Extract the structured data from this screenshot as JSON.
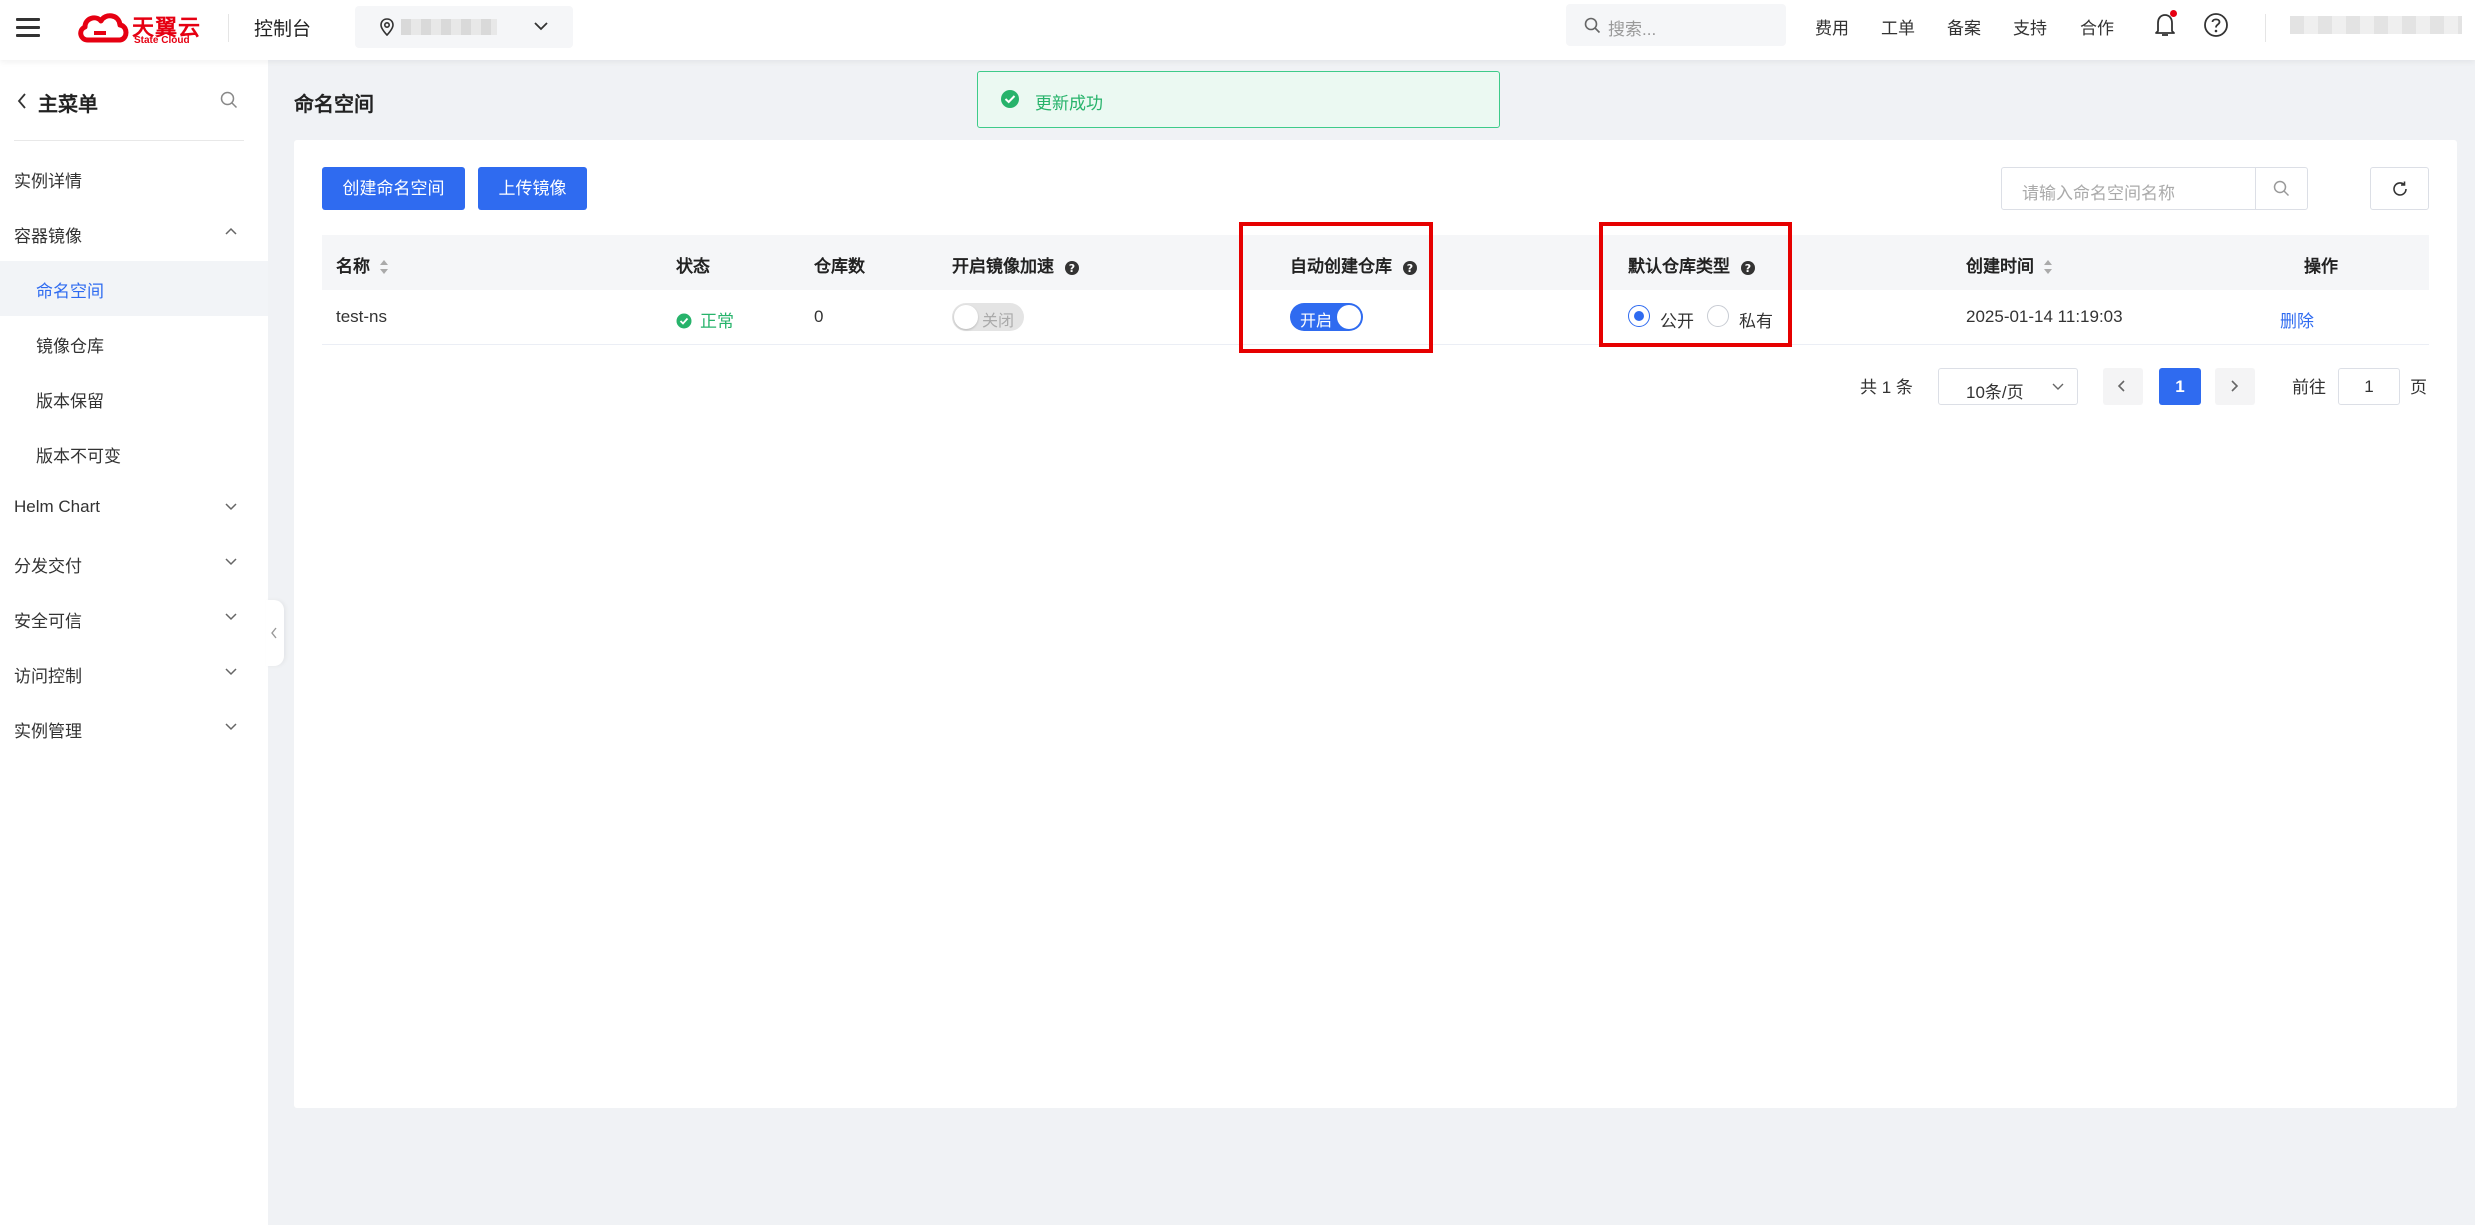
{
  "topbar": {
    "logo_text": "天翼云",
    "logo_sub": "State Cloud",
    "console": "控制台",
    "search_placeholder": "搜索...",
    "links": [
      "费用",
      "工单",
      "备案",
      "支持",
      "合作"
    ]
  },
  "sidebar": {
    "title": "主菜单",
    "items": [
      {
        "label": "实例详情"
      },
      {
        "label": "容器镜像"
      },
      {
        "label": "命名空间"
      },
      {
        "label": "镜像仓库"
      },
      {
        "label": "版本保留"
      },
      {
        "label": "版本不可变"
      },
      {
        "label": "Helm Chart"
      },
      {
        "label": "分发交付"
      },
      {
        "label": "安全可信"
      },
      {
        "label": "访问控制"
      },
      {
        "label": "实例管理"
      }
    ]
  },
  "page": {
    "title": "命名空间",
    "toast": "更新成功",
    "create_button": "创建命名空间",
    "upload_button": "上传镜像",
    "search_placeholder": "请输入命名空间名称"
  },
  "table": {
    "headers": [
      "名称",
      "状态",
      "仓库数",
      "开启镜像加速",
      "自动创建仓库",
      "默认仓库类型",
      "创建时间",
      "操作"
    ],
    "rows": [
      {
        "name": "test-ns",
        "status": "正常",
        "repo_count": "0",
        "accel_label": "关闭",
        "auto_create_label": "开启",
        "type_public": "公开",
        "type_private": "私有",
        "created": "2025-01-14 11:19:03",
        "action": "删除"
      }
    ]
  },
  "pagination": {
    "total": "共 1 条",
    "page_size": "10条/页",
    "current": "1",
    "goto_label": "前往",
    "goto_value": "1",
    "goto_suffix": "页"
  },
  "colors": {
    "primary": "#2f6bf0",
    "success": "#27b36b",
    "highlight": "#e60000",
    "brand": "#e60012"
  }
}
